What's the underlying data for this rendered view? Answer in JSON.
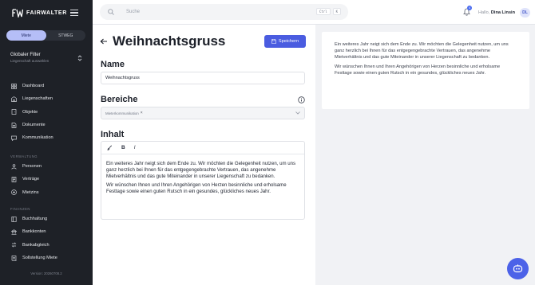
{
  "sidebar": {
    "brand": "FAIRWALTER",
    "tabs": [
      {
        "label": "Miete",
        "active": true
      },
      {
        "label": "STWEG",
        "active": false
      }
    ],
    "filter": {
      "title": "Globaler Filter",
      "subtitle": "Liegenschaft auswählen"
    },
    "main_items": [
      {
        "label": "Dashboard",
        "icon": "grid-icon"
      },
      {
        "label": "Liegenschaften",
        "icon": "building-icon"
      },
      {
        "label": "Objekte",
        "icon": "door-icon"
      },
      {
        "label": "Dokumente",
        "icon": "document-icon"
      },
      {
        "label": "Kommunikation",
        "icon": "chat-icon"
      }
    ],
    "section_verwaltung": "VERWALTUNG",
    "verwaltung_items": [
      {
        "label": "Personen",
        "icon": "person-icon"
      },
      {
        "label": "Verträge",
        "icon": "contract-icon"
      },
      {
        "label": "Mietzins",
        "icon": "rent-icon"
      }
    ],
    "section_finanzen": "FINANZEN",
    "finanzen_items": [
      {
        "label": "Buchhaltung",
        "icon": "ledger-icon"
      },
      {
        "label": "Bankkonten",
        "icon": "bank-icon"
      },
      {
        "label": "Bankabgleich",
        "icon": "reconcile-icon"
      },
      {
        "label": "Sollstellung Miete",
        "icon": "invoice-icon"
      }
    ],
    "version": "Version: 20260708.2"
  },
  "topbar": {
    "search_placeholder": "Suche",
    "shortcut": [
      "Ctrl",
      "K"
    ],
    "notification_count": "4",
    "greeting_prefix": "Hallo,",
    "user_name": "Dina Linsin",
    "avatar_initials": "DL"
  },
  "editor": {
    "title": "Weihnachtsgruss",
    "save_label": "Speichern",
    "name_label": "Name",
    "name_value": "Weihnachtsgruss",
    "bereiche_label": "Bereiche",
    "bereiche_chip": "Mieterkommunikation",
    "inhalt_label": "Inhalt",
    "toolbar": [
      "B",
      "I"
    ],
    "content_p1": "Ein weiteres Jahr neigt sich dem Ende zu. Wir möchten die Gelegenheit nutzen, um uns ganz herzlich bei Ihnen für das entgegengebrachte Vertrauen, das angenehme Mietverhältnis und das gute Miteinander in unserer Liegenschaft zu bedanken.",
    "content_p2": "Wir wünschen Ihnen und Ihren Angehörigen von Herzen besinnliche und erholsame Festtage sowie einen guten Rutsch in ein gesundes, glückliches neues Jahr."
  },
  "preview": {
    "p1": "Ein weiteres Jahr neigt sich dem Ende zu. Wir möchten die Gelegenheit nutzen, um uns ganz herzlich bei Ihnen für das entgegengebrachte Vertrauen, das angenehme Mietverhältnis und das gute Miteinander in unserer Liegenschaft zu bedanken.",
    "p2": "Wir wünschen Ihnen und Ihren Angehörigen von Herzen besinnliche und erholsame Festtage sowie einen guten Rutsch in ein gesundes, glückliches neues Jahr."
  },
  "colors": {
    "sidebar_bg": "#1e2127",
    "accent": "#4a5ce0",
    "active_tab": "#b5bef7"
  }
}
